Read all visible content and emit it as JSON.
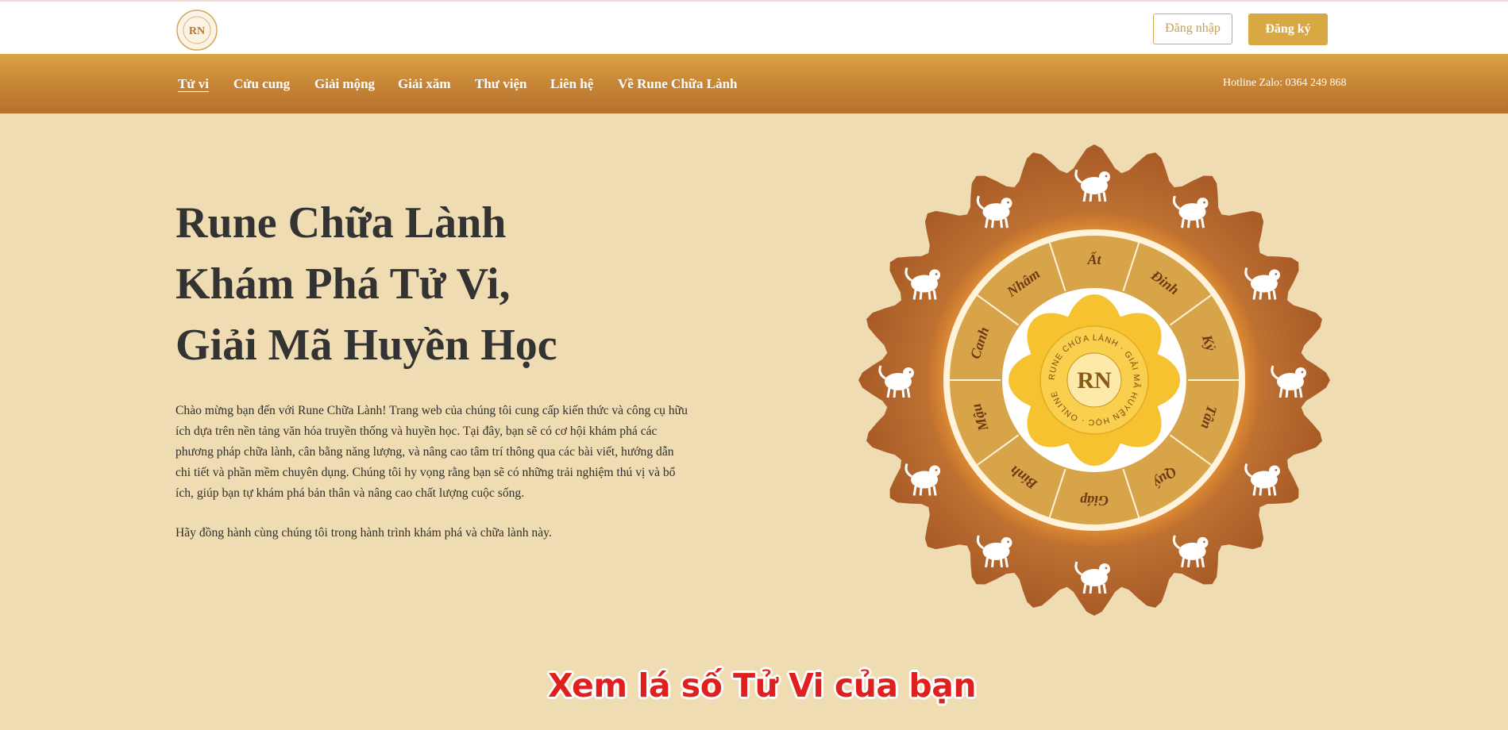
{
  "header": {
    "logo_text": "RN",
    "login_label": "Đăng nhập",
    "register_label": "Đăng ký"
  },
  "nav": {
    "items": [
      {
        "label": "Tử vi",
        "active": true
      },
      {
        "label": "Cửu cung"
      },
      {
        "label": "Giải mộng"
      },
      {
        "label": "Giải xăm"
      },
      {
        "label": "Thư viện"
      },
      {
        "label": "Liên hệ"
      },
      {
        "label": "Về Rune Chữa Lành"
      }
    ],
    "hotline": "Hotline Zalo: 0364 249 868"
  },
  "hero": {
    "title_lines": [
      "Rune Chữa Lành",
      "Khám Phá Tử Vi,",
      "Giải Mã Huyền Học"
    ],
    "paragraph_1": "Chào mừng bạn đến với Rune Chữa Lành! Trang web của chúng tôi cung cấp kiến thức và công cụ hữu ích dựa trên nền tảng văn hóa truyền thống và huyền học. Tại đây, bạn sẽ có cơ hội khám phá các phương pháp chữa lành, cân bằng năng lượng, và nâng cao tâm trí thông qua các bài viết, hướng dẫn chi tiết và phần mềm chuyên dụng. Chúng tôi hy vọng rằng bạn sẽ có những trải nghiệm thú vị và bổ ích, giúp bạn tự khám phá bản thân và nâng cao chất lượng cuộc sống.",
    "paragraph_2": "Hãy đồng hành cùng chúng tôi trong hành trình khám phá và chữa lành này."
  },
  "wheel": {
    "center_logo": "RN",
    "center_ring_text": "RUNE CHỮA LÀNH · GIẢI MÃ HUYỀN HỌC · ONLINE",
    "stems": [
      "Ất",
      "Đinh",
      "Kỷ",
      "Tân",
      "Quý",
      "Giáp",
      "Bính",
      "Mậu",
      "Canh",
      "Nhâm"
    ],
    "zodiac_icons": [
      "rooster-icon",
      "dog-icon",
      "pig-icon",
      "rat-icon",
      "ox-icon",
      "tiger-icon",
      "cat-icon",
      "dragon-icon",
      "snake-icon",
      "horse-icon",
      "goat-icon",
      "monkey-icon"
    ],
    "colors": {
      "outer": "#b86a2e",
      "glow": "#f0a030",
      "ring": "#d7a44a",
      "center": "#f6c230"
    }
  },
  "cta": {
    "label": "Xem lá số Tử Vi của bạn"
  },
  "colors": {
    "background": "#efdcb2",
    "nav_top": "#daa445",
    "nav_bottom": "#b8702e",
    "accent": "#d8a943",
    "cta": "#e0201e"
  }
}
